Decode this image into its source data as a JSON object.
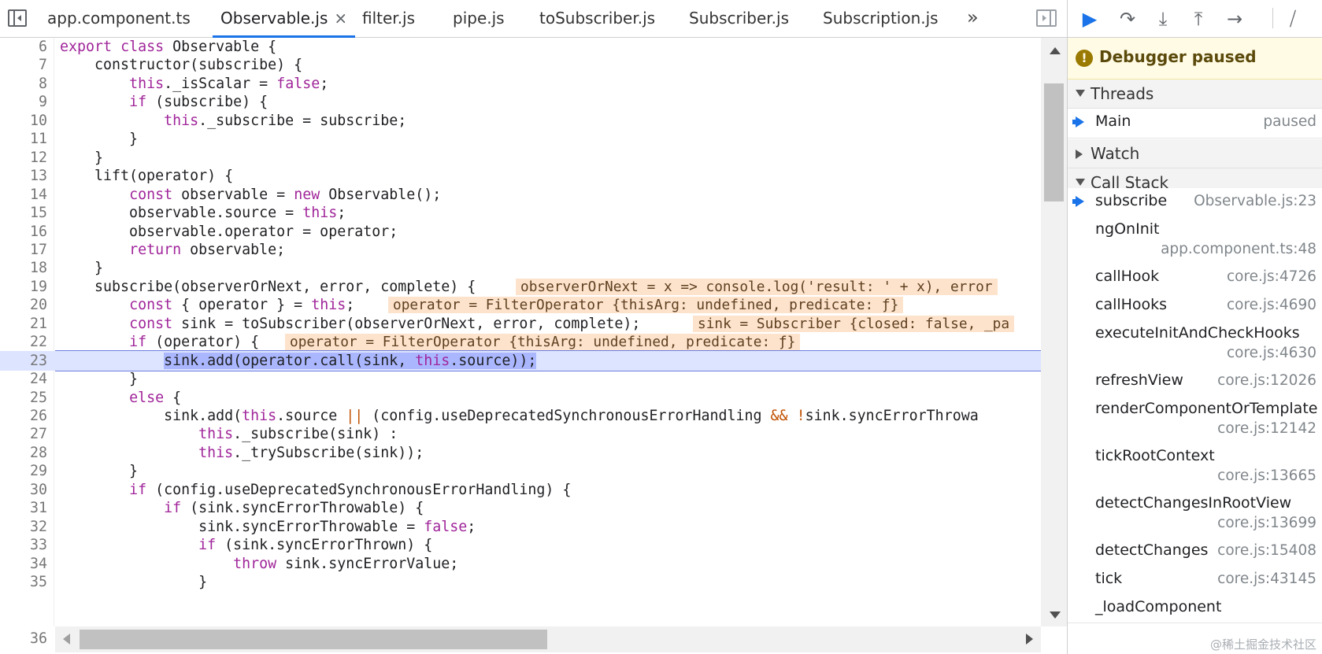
{
  "editor": {
    "tabs": [
      {
        "label": "app.component.ts"
      },
      {
        "label": "Observable.js",
        "close": "×"
      },
      {
        "label": "filter.js"
      },
      {
        "label": "pipe.js"
      },
      {
        "label": "toSubscriber.js"
      },
      {
        "label": "Subscriber.js"
      },
      {
        "label": "Subscription.js"
      }
    ],
    "overflow_label": "»",
    "active_tab_index": 1,
    "current_line": 23,
    "last_line_number": "36",
    "lines": [
      {
        "n": "6",
        "code": "export class Observable {"
      },
      {
        "n": "7",
        "code": "    constructor(subscribe) {"
      },
      {
        "n": "8",
        "code": "        this._isScalar = false;"
      },
      {
        "n": "9",
        "code": "        if (subscribe) {"
      },
      {
        "n": "10",
        "code": "            this._subscribe = subscribe;"
      },
      {
        "n": "11",
        "code": "        }"
      },
      {
        "n": "12",
        "code": "    }"
      },
      {
        "n": "13",
        "code": "    lift(operator) {"
      },
      {
        "n": "14",
        "code": "        const observable = new Observable();"
      },
      {
        "n": "15",
        "code": "        observable.source = this;"
      },
      {
        "n": "16",
        "code": "        observable.operator = operator;"
      },
      {
        "n": "17",
        "code": "        return observable;"
      },
      {
        "n": "18",
        "code": "    }"
      },
      {
        "n": "19",
        "code": "    subscribe(observerOrNext, error, complete) {",
        "inline": "observerOrNext = x => console.log('result: ' + x), error"
      },
      {
        "n": "20",
        "code": "        const { operator } = this;",
        "inline": "operator = FilterOperator {thisArg: undefined, predicate: ƒ}"
      },
      {
        "n": "21",
        "code": "        const sink = toSubscriber(observerOrNext, error, complete);",
        "inline": "sink = Subscriber {closed: false, _pa"
      },
      {
        "n": "22",
        "code": "        if (operator) {",
        "inline": "operator = FilterOperator {thisArg: undefined, predicate: ƒ}"
      },
      {
        "n": "23",
        "code": "            sink.add(operator.call(sink, this.source));"
      },
      {
        "n": "24",
        "code": "        }"
      },
      {
        "n": "25",
        "code": "        else {"
      },
      {
        "n": "26",
        "code": "            sink.add(this.source || (config.useDeprecatedSynchronousErrorHandling && !sink.syncErrorThrowa"
      },
      {
        "n": "27",
        "code": "                this._subscribe(sink) :"
      },
      {
        "n": "28",
        "code": "                this._trySubscribe(sink));"
      },
      {
        "n": "29",
        "code": "        }"
      },
      {
        "n": "30",
        "code": "        if (config.useDeprecatedSynchronousErrorHandling) {"
      },
      {
        "n": "31",
        "code": "            if (sink.syncErrorThrowable) {"
      },
      {
        "n": "32",
        "code": "                sink.syncErrorThrowable = false;"
      },
      {
        "n": "33",
        "code": "                if (sink.syncErrorThrown) {"
      },
      {
        "n": "34",
        "code": "                    throw sink.syncErrorValue;"
      },
      {
        "n": "35",
        "code": "                }"
      }
    ]
  },
  "debugger": {
    "toolbar": [
      {
        "name": "resume-button",
        "icon": "resume-icon",
        "glyph": "▶"
      },
      {
        "name": "step-over-button",
        "icon": "step-over-icon",
        "glyph": "↷"
      },
      {
        "name": "step-into-button",
        "icon": "step-into-icon",
        "glyph": "⤓"
      },
      {
        "name": "step-out-button",
        "icon": "step-out-icon",
        "glyph": "⤒"
      },
      {
        "name": "step-button",
        "icon": "step-icon",
        "glyph": "→"
      },
      {
        "name": "deactivate-breakpoints-button",
        "icon": "deactivate-breakpoints-icon",
        "glyph": "⧸"
      }
    ],
    "paused_label": "Debugger paused",
    "threads_label": "Threads",
    "main_thread": {
      "name": "Main",
      "status": "paused"
    },
    "watch_label": "Watch",
    "call_stack_label": "Call Stack",
    "call_stack": [
      {
        "name": "subscribe",
        "loc": "Observable.js:23",
        "wrap": false,
        "active": true
      },
      {
        "name": "ngOnInit",
        "loc": "app.component.ts:48",
        "wrap": true
      },
      {
        "name": "callHook",
        "loc": "core.js:4726",
        "wrap": false
      },
      {
        "name": "callHooks",
        "loc": "core.js:4690",
        "wrap": false
      },
      {
        "name": "executeInitAndCheckHooks",
        "loc": "core.js:4630",
        "wrap": true
      },
      {
        "name": "refreshView",
        "loc": "core.js:12026",
        "wrap": false
      },
      {
        "name": "renderComponentOrTemplate",
        "loc": "core.js:12142",
        "wrap": true
      },
      {
        "name": "tickRootContext",
        "loc": "core.js:13665",
        "wrap": true
      },
      {
        "name": "detectChangesInRootView",
        "loc": "core.js:13699",
        "wrap": true
      },
      {
        "name": "detectChanges",
        "loc": "core.js:15408",
        "wrap": false
      },
      {
        "name": "tick",
        "loc": "core.js:43145",
        "wrap": false
      },
      {
        "name": "_loadComponent",
        "loc": "",
        "wrap": false
      }
    ],
    "watermark": "@稀土掘金技术社区"
  }
}
